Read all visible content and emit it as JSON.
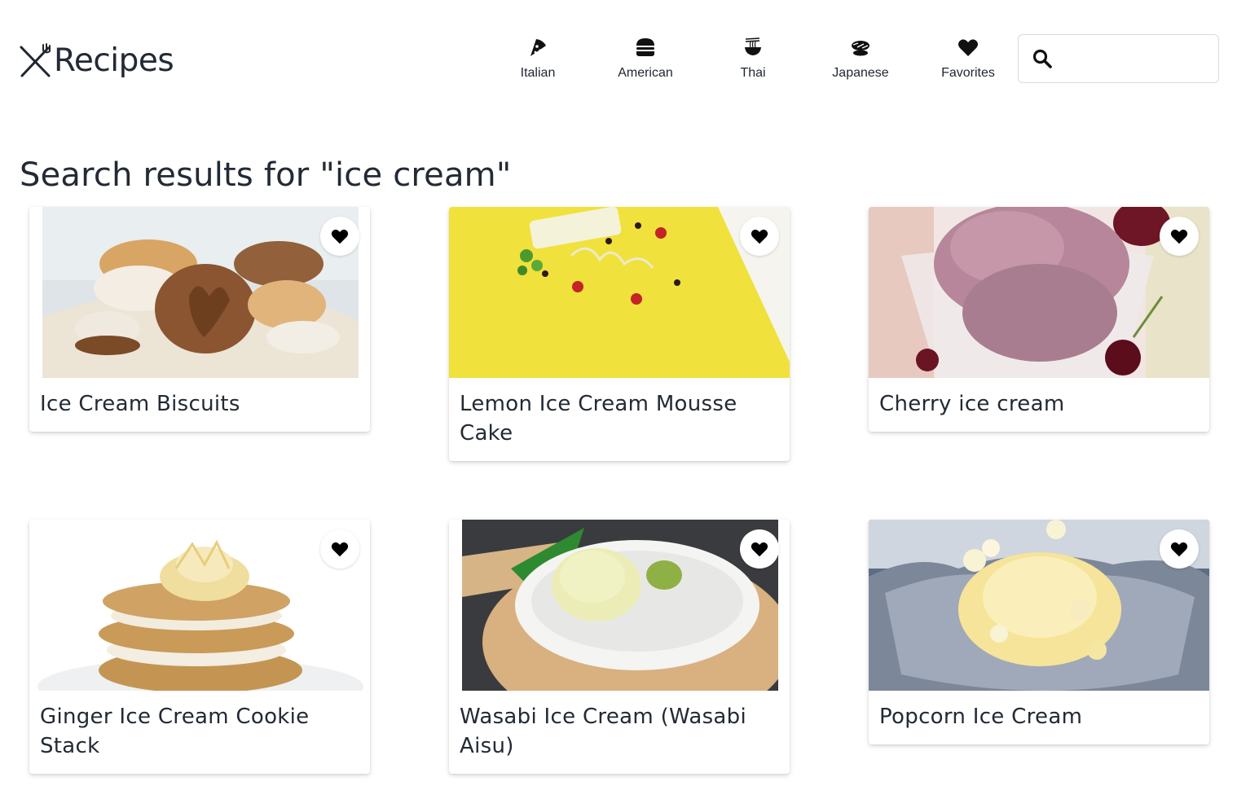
{
  "app": {
    "logo_text": "Recipes",
    "logo_icon": "fork-knife-icon"
  },
  "nav": {
    "items": [
      {
        "label": "Italian",
        "icon": "pizza-icon"
      },
      {
        "label": "American",
        "icon": "hamburger-icon"
      },
      {
        "label": "Thai",
        "icon": "noodle-bowl-icon"
      },
      {
        "label": "Japanese",
        "icon": "sushi-icon"
      },
      {
        "label": "Favorites",
        "icon": "heart-icon"
      }
    ]
  },
  "search": {
    "icon": "search-icon",
    "value": "",
    "placeholder": ""
  },
  "results": {
    "title": "Search results for \"ice cream\"",
    "cards": [
      {
        "title": "Ice Cream Biscuits"
      },
      {
        "title": "Lemon Ice Cream Mousse Cake"
      },
      {
        "title": "Cherry ice cream"
      },
      {
        "title": "Ginger Ice Cream Cookie Stack"
      },
      {
        "title": "Wasabi Ice Cream (Wasabi Aisu)"
      },
      {
        "title": "Popcorn Ice Cream"
      }
    ],
    "favorite_icon": "heart-icon"
  },
  "colors": {
    "text": "#222a35",
    "icon": "#111111",
    "background": "#ffffff",
    "search_border": "#d8dbe0"
  }
}
